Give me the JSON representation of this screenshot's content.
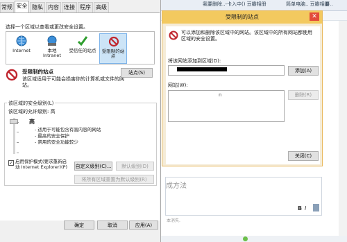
{
  "browser": {
    "tabs": [
      "要..",
      "我要删除..-卡入中() 豆瓣相册",
      "简单电脑.. 豆瓣相册"
    ],
    "editor_hint": "成方法",
    "footer_note": "本消失."
  },
  "internet_options": {
    "tabs": [
      "常规",
      "安全",
      "隐私",
      "内容",
      "连接",
      "程序",
      "高级"
    ],
    "zones_prompt": "选择一个区域以查看或更改安全设置。",
    "zones": [
      {
        "label": "Internet",
        "icon": "globe-icon"
      },
      {
        "label": "本地 Intranet",
        "icon": "intranet-icon"
      },
      {
        "label": "受信任的站点",
        "icon": "checkmark-icon"
      },
      {
        "label": "受限制的站点",
        "icon": "restricted-icon"
      }
    ],
    "zone_title": "受限制的站点",
    "zone_desc": "该区域适用于可能会损害你的计算机或文件的网站。",
    "sites_button": "站点(S)",
    "security_level_group": "该区域的安全级别(L)",
    "allowed_levels": "该区域的允许级别: 高",
    "level_name": "高",
    "level_bullets": [
      "- 适用于可能包含有害内容的网站",
      "- 最高的安全保护",
      "- 禁用的安全功能较少"
    ],
    "protected_mode": "启用保护模式(要求重新启动 Internet Explorer)(P)",
    "protected_mode_checked": true,
    "custom_level_button": "自定义级别(C)...",
    "default_level_button": "默认级别(D)",
    "reset_all_button": "将所有区域重置为默认级别(R)",
    "ok_button": "确定",
    "cancel_button": "取消",
    "apply_button": "应用(A)"
  },
  "restricted_dialog": {
    "title": "受限制的站点",
    "close_glyph": "✕",
    "info": "可以添加和删除该区域中的网站。该区域中的所有网站都使用区域的安全设置。",
    "add_prompt": "将该网站添加到区域(D):",
    "add_button": "添加(A)",
    "sites_label": "网站(W):",
    "sites_list_marker": "n",
    "remove_button": "删除(R)",
    "close_button": "关闭(C)"
  },
  "colors": {
    "restricted_title_bar": "#f3c95f",
    "restricted_border": "#e8b85a",
    "selected_zone": "#cce4f7",
    "restricted_icon": "#c0262f"
  }
}
